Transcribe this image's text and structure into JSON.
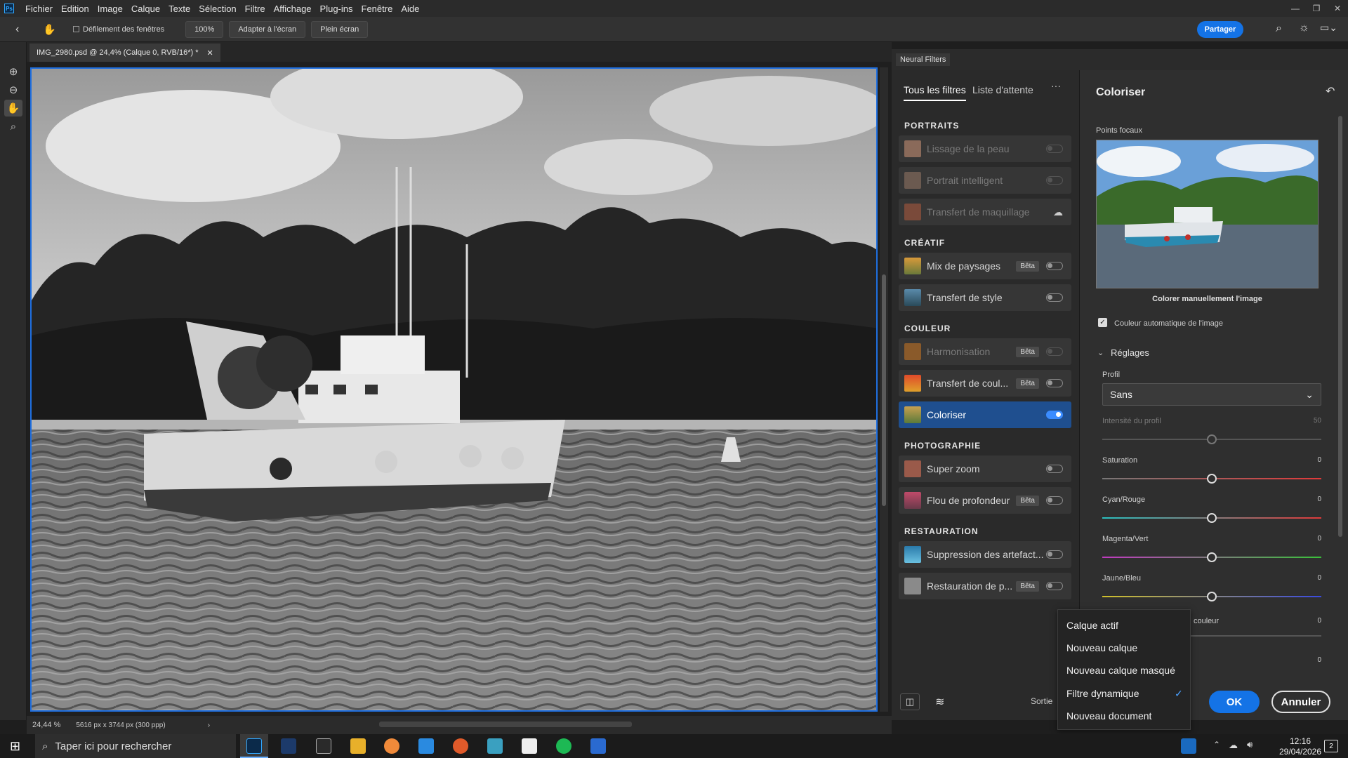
{
  "menubar": {
    "items": [
      "Fichier",
      "Edition",
      "Image",
      "Calque",
      "Texte",
      "Sélection",
      "Filtre",
      "Affichage",
      "Plug-ins",
      "Fenêtre",
      "Aide"
    ]
  },
  "options": {
    "scroll_all_label": "Défilement des fenêtres",
    "zoom": "100%",
    "fit": "Adapter à l'écran",
    "fill": "Plein écran",
    "share": "Partager"
  },
  "document": {
    "tab_title": "IMG_2980.psd @ 24,4% (Calque 0, RVB/16*) *",
    "zoom": "24,44 %",
    "info": "5616 px x 3744 px (300 ppp)"
  },
  "neural": {
    "title": "Neural Filters",
    "tab_all": "Tous les filtres",
    "tab_wait": "Liste d'attente",
    "more": "···",
    "beta_label": "Bêta",
    "sections": {
      "portraits": "PORTRAITS",
      "creatif": "CRÉATIF",
      "couleur": "COULEUR",
      "photo": "PHOTOGRAPHIE",
      "restoration": "RESTAURATION"
    },
    "filters": [
      "Lissage de la peau",
      "Portrait intelligent",
      "Transfert de maquillage",
      "Mix de paysages",
      "Transfert de style",
      "Harmonisation",
      "Transfert de coul...",
      "Coloriser",
      "Super zoom",
      "Flou de profondeur",
      "Suppression des artefact...",
      "Restauration de p..."
    ]
  },
  "settings": {
    "title": "Coloriser",
    "focus_label": "Points focaux",
    "manual": "Colorer manuellement l'image",
    "auto_color": "Couleur automatique de l'image",
    "reglages": "Réglages",
    "profil_label": "Profil",
    "profil_value": "Sans",
    "sliders": [
      {
        "label": "Intensité du profil",
        "value": "50",
        "pos": 0.5
      },
      {
        "label": "Saturation",
        "value": "0",
        "pos": 0.5
      },
      {
        "label": "Cyan/Rouge",
        "value": "0",
        "pos": 0.5
      },
      {
        "label": "Magenta/Vert",
        "value": "0",
        "pos": 0.5
      },
      {
        "label": "Jaune/Bleu",
        "value": "0",
        "pos": 0.5
      }
    ],
    "partial_label": "couleur",
    "partial_val1": "0",
    "partial_val2": "0"
  },
  "output": {
    "label": "Sortie",
    "menu": [
      "Calque actif",
      "Nouveau calque",
      "Nouveau calque masqué",
      "Filtre dynamique",
      "Nouveau document"
    ],
    "selected": "Filtre dynamique"
  },
  "dialog": {
    "ok": "OK",
    "cancel": "Annuler"
  },
  "taskbar": {
    "search": "Taper ici pour rechercher",
    "time": "12:16",
    "date": "29/04/2026",
    "notif": "2"
  }
}
